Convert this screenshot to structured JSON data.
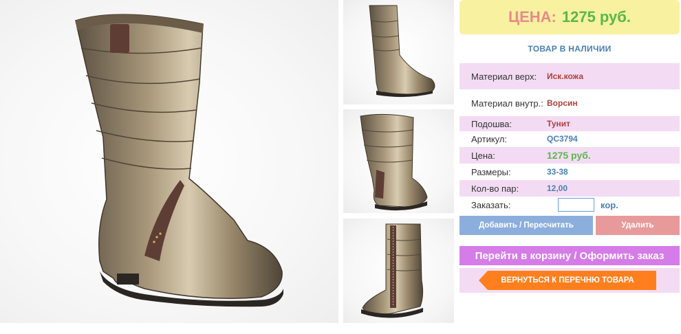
{
  "price_box": {
    "label": "ЦЕНА:",
    "value": "1275 руб."
  },
  "stock_status": "ТОВАР В НАЛИЧИИ",
  "specs": [
    {
      "label": "Материал верх:",
      "value": "Иск.кожа"
    },
    {
      "label": "Материал внутр.:",
      "value": "Ворсин"
    },
    {
      "label": "Подошва:",
      "value": "Тунит"
    },
    {
      "label": "Артикул:",
      "value": "QC3794"
    },
    {
      "label": "Цена:",
      "value": "1275 руб."
    },
    {
      "label": "Размеры:",
      "value": "33-38"
    },
    {
      "label": "Кол-во пар:",
      "value": "12,00"
    }
  ],
  "order": {
    "label": "Заказать:",
    "input_value": "",
    "unit": "кор."
  },
  "buttons": {
    "add": "Добавить / Пересчитать",
    "delete": "Удалить",
    "cart": "Перейти в корзину / Оформить заказ",
    "back": "ВЕРНУТЬСЯ К ПЕРЕЧНЮ ТОВАРА"
  },
  "colors": {
    "price_box_bg": "#f8f1a0",
    "price_label": "#e98a8a",
    "price_value": "#58b84a",
    "row_highlight": "#f3dcf3",
    "add_button": "#8caedc",
    "delete_button": "#e89a9a",
    "cart_button": "#d57ce8",
    "back_button": "#ff7f1e",
    "boot_metallic": "#8a7a62",
    "boot_suede": "#5e3e34"
  },
  "images": {
    "main": "boot-main-photo",
    "thumbnails": [
      "boot-side-view",
      "boot-front-view",
      "boot-zipper-view"
    ]
  }
}
